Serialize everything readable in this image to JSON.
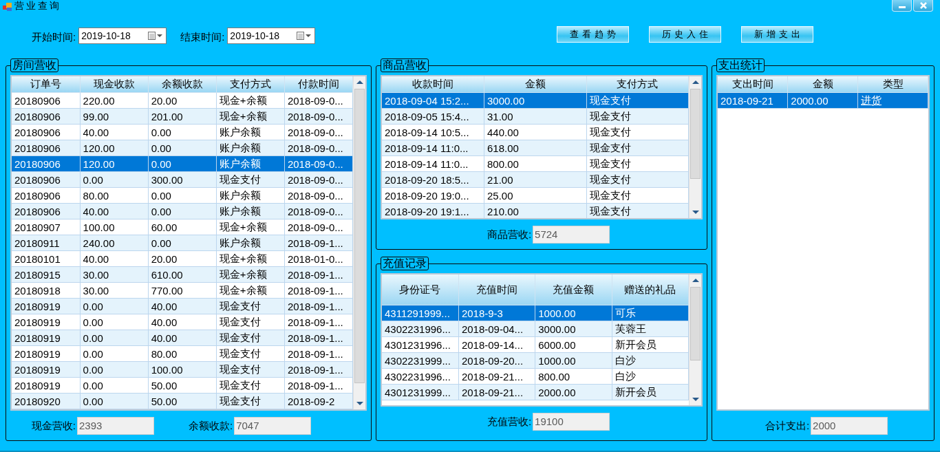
{
  "window": {
    "title": "营业查询"
  },
  "filters": [
    {
      "label": "开始时间:",
      "value": "2019-10-18"
    },
    {
      "label": "结束时间:",
      "value": "2019-10-18"
    }
  ],
  "buttons": [
    "查看趋势",
    "历史入住",
    "新增支出"
  ],
  "room_revenue": {
    "title": "房间营收",
    "table": {
      "scrollbar": true,
      "columns": [
        {
          "label": "订单号",
          "kind": "text"
        },
        {
          "label": "现金收款",
          "kind": "text"
        },
        {
          "label": "余额收款",
          "kind": "text"
        },
        {
          "label": "支付方式",
          "kind": "text"
        },
        {
          "label": "付款时间",
          "kind": "text"
        }
      ],
      "rows": [
        {
          "cells": [
            "20180906",
            "220.00",
            "20.00",
            "现金+余额",
            "2018-09-0..."
          ],
          "selected": false
        },
        {
          "cells": [
            "20180906",
            "99.00",
            "201.00",
            "现金+余额",
            "2018-09-0..."
          ],
          "selected": false
        },
        {
          "cells": [
            "20180906",
            "40.00",
            "0.00",
            "账户余额",
            "2018-09-0..."
          ],
          "selected": false
        },
        {
          "cells": [
            "20180906",
            "120.00",
            "0.00",
            "账户余额",
            "2018-09-0..."
          ],
          "selected": false
        },
        {
          "cells": [
            "20180906",
            "120.00",
            "0.00",
            "账户余额",
            "2018-09-0..."
          ],
          "selected": true
        },
        {
          "cells": [
            "20180906",
            "0.00",
            "300.00",
            "现金支付",
            "2018-09-0..."
          ],
          "selected": false
        },
        {
          "cells": [
            "20180906",
            "80.00",
            "0.00",
            "账户余额",
            "2018-09-0..."
          ],
          "selected": false
        },
        {
          "cells": [
            "20180906",
            "40.00",
            "0.00",
            "账户余额",
            "2018-09-0..."
          ],
          "selected": false
        },
        {
          "cells": [
            "20180907",
            "100.00",
            "60.00",
            "现金+余额",
            "2018-09-0..."
          ],
          "selected": false
        },
        {
          "cells": [
            "20180911",
            "240.00",
            "0.00",
            "账户余额",
            "2018-09-1..."
          ],
          "selected": false
        },
        {
          "cells": [
            "20180101",
            "40.00",
            "20.00",
            "现金+余额",
            "2018-01-0..."
          ],
          "selected": false
        },
        {
          "cells": [
            "20180915",
            "30.00",
            "610.00",
            "现金+余额",
            "2018-09-1..."
          ],
          "selected": false
        },
        {
          "cells": [
            "20180918",
            "30.00",
            "770.00",
            "现金+余额",
            "2018-09-1..."
          ],
          "selected": false
        },
        {
          "cells": [
            "20180919",
            "0.00",
            "40.00",
            "现金支付",
            "2018-09-1..."
          ],
          "selected": false
        },
        {
          "cells": [
            "20180919",
            "0.00",
            "40.00",
            "现金支付",
            "2018-09-1..."
          ],
          "selected": false
        },
        {
          "cells": [
            "20180919",
            "0.00",
            "40.00",
            "现金支付",
            "2018-09-1..."
          ],
          "selected": false
        },
        {
          "cells": [
            "20180919",
            "0.00",
            "80.00",
            "现金支付",
            "2018-09-1..."
          ],
          "selected": false
        },
        {
          "cells": [
            "20180919",
            "0.00",
            "100.00",
            "现金支付",
            "2018-09-1..."
          ],
          "selected": false
        },
        {
          "cells": [
            "20180919",
            "0.00",
            "50.00",
            "现金支付",
            "2018-09-1..."
          ],
          "selected": false
        },
        {
          "cells": [
            "20180920",
            "0.00",
            "50.00",
            "现金支付",
            "2018-09-2"
          ],
          "selected": false
        }
      ]
    },
    "summary": [
      {
        "label": "现金营收:",
        "value": "2393"
      },
      {
        "label": "余额收款:",
        "value": "7047"
      }
    ]
  },
  "goods_revenue": {
    "title": "商品营收",
    "table": {
      "scrollbar": true,
      "columns": [
        {
          "label": "收款时间",
          "kind": "text"
        },
        {
          "label": "金额",
          "kind": "text"
        },
        {
          "label": "支付方式",
          "kind": "text"
        }
      ],
      "rows": [
        {
          "cells": [
            "2018-09-04 15:2...",
            "3000.00",
            "现金支付"
          ],
          "selected": true
        },
        {
          "cells": [
            "2018-09-05 15:4...",
            "31.00",
            "现金支付"
          ],
          "selected": false
        },
        {
          "cells": [
            "2018-09-14 10:5...",
            "440.00",
            "现金支付"
          ],
          "selected": false
        },
        {
          "cells": [
            "2018-09-14 11:0...",
            "618.00",
            "现金支付"
          ],
          "selected": false
        },
        {
          "cells": [
            "2018-09-14 11:0...",
            "800.00",
            "现金支付"
          ],
          "selected": false
        },
        {
          "cells": [
            "2018-09-20 18:5...",
            "21.00",
            "现金支付"
          ],
          "selected": false
        },
        {
          "cells": [
            "2018-09-20 19:0...",
            "25.00",
            "现金支付"
          ],
          "selected": false
        },
        {
          "cells": [
            "2018-09-20 19:1...",
            "210.00",
            "现金支付"
          ],
          "selected": false
        }
      ]
    },
    "summary": [
      {
        "label": "商品营收:",
        "value": "5724"
      }
    ]
  },
  "recharge_records": {
    "title": "充值记录",
    "table": {
      "scrollbar": true,
      "columns": [
        {
          "label": "身份证号",
          "kind": "text"
        },
        {
          "label": "充值时间",
          "kind": "text"
        },
        {
          "label": "充值金额",
          "kind": "text"
        },
        {
          "label": "赠送的礼品",
          "kind": "text"
        }
      ],
      "rows": [
        {
          "cells": [
            "4311291999...",
            "2018-9-3",
            "1000.00",
            "可乐"
          ],
          "selected": true
        },
        {
          "cells": [
            "4302231996...",
            "2018-09-04...",
            "3000.00",
            "芙蓉王"
          ],
          "selected": false
        },
        {
          "cells": [
            "4301231996...",
            "2018-09-14...",
            "6000.00",
            "新开会员"
          ],
          "selected": false
        },
        {
          "cells": [
            "4302231999...",
            "2018-09-20...",
            "1000.00",
            "白沙"
          ],
          "selected": false
        },
        {
          "cells": [
            "4302231996...",
            "2018-09-21...",
            "800.00",
            "白沙"
          ],
          "selected": false
        },
        {
          "cells": [
            "4301231999...",
            "2018-09-21...",
            "2000.00",
            "新开会员"
          ],
          "selected": false
        }
      ]
    },
    "summary": [
      {
        "label": "充值营收:",
        "value": "19100"
      }
    ]
  },
  "expense_stats": {
    "title": "支出统计",
    "table": {
      "scrollbar": false,
      "columns": [
        {
          "label": "支出时间",
          "kind": "text"
        },
        {
          "label": "金额",
          "kind": "text"
        },
        {
          "label": "类型",
          "kind": "link"
        }
      ],
      "rows": [
        {
          "cells": [
            "2018-09-21",
            "2000.00",
            "进货"
          ],
          "selected": true
        }
      ]
    },
    "summary": [
      {
        "label": "合计支出:",
        "value": "2000"
      }
    ]
  }
}
